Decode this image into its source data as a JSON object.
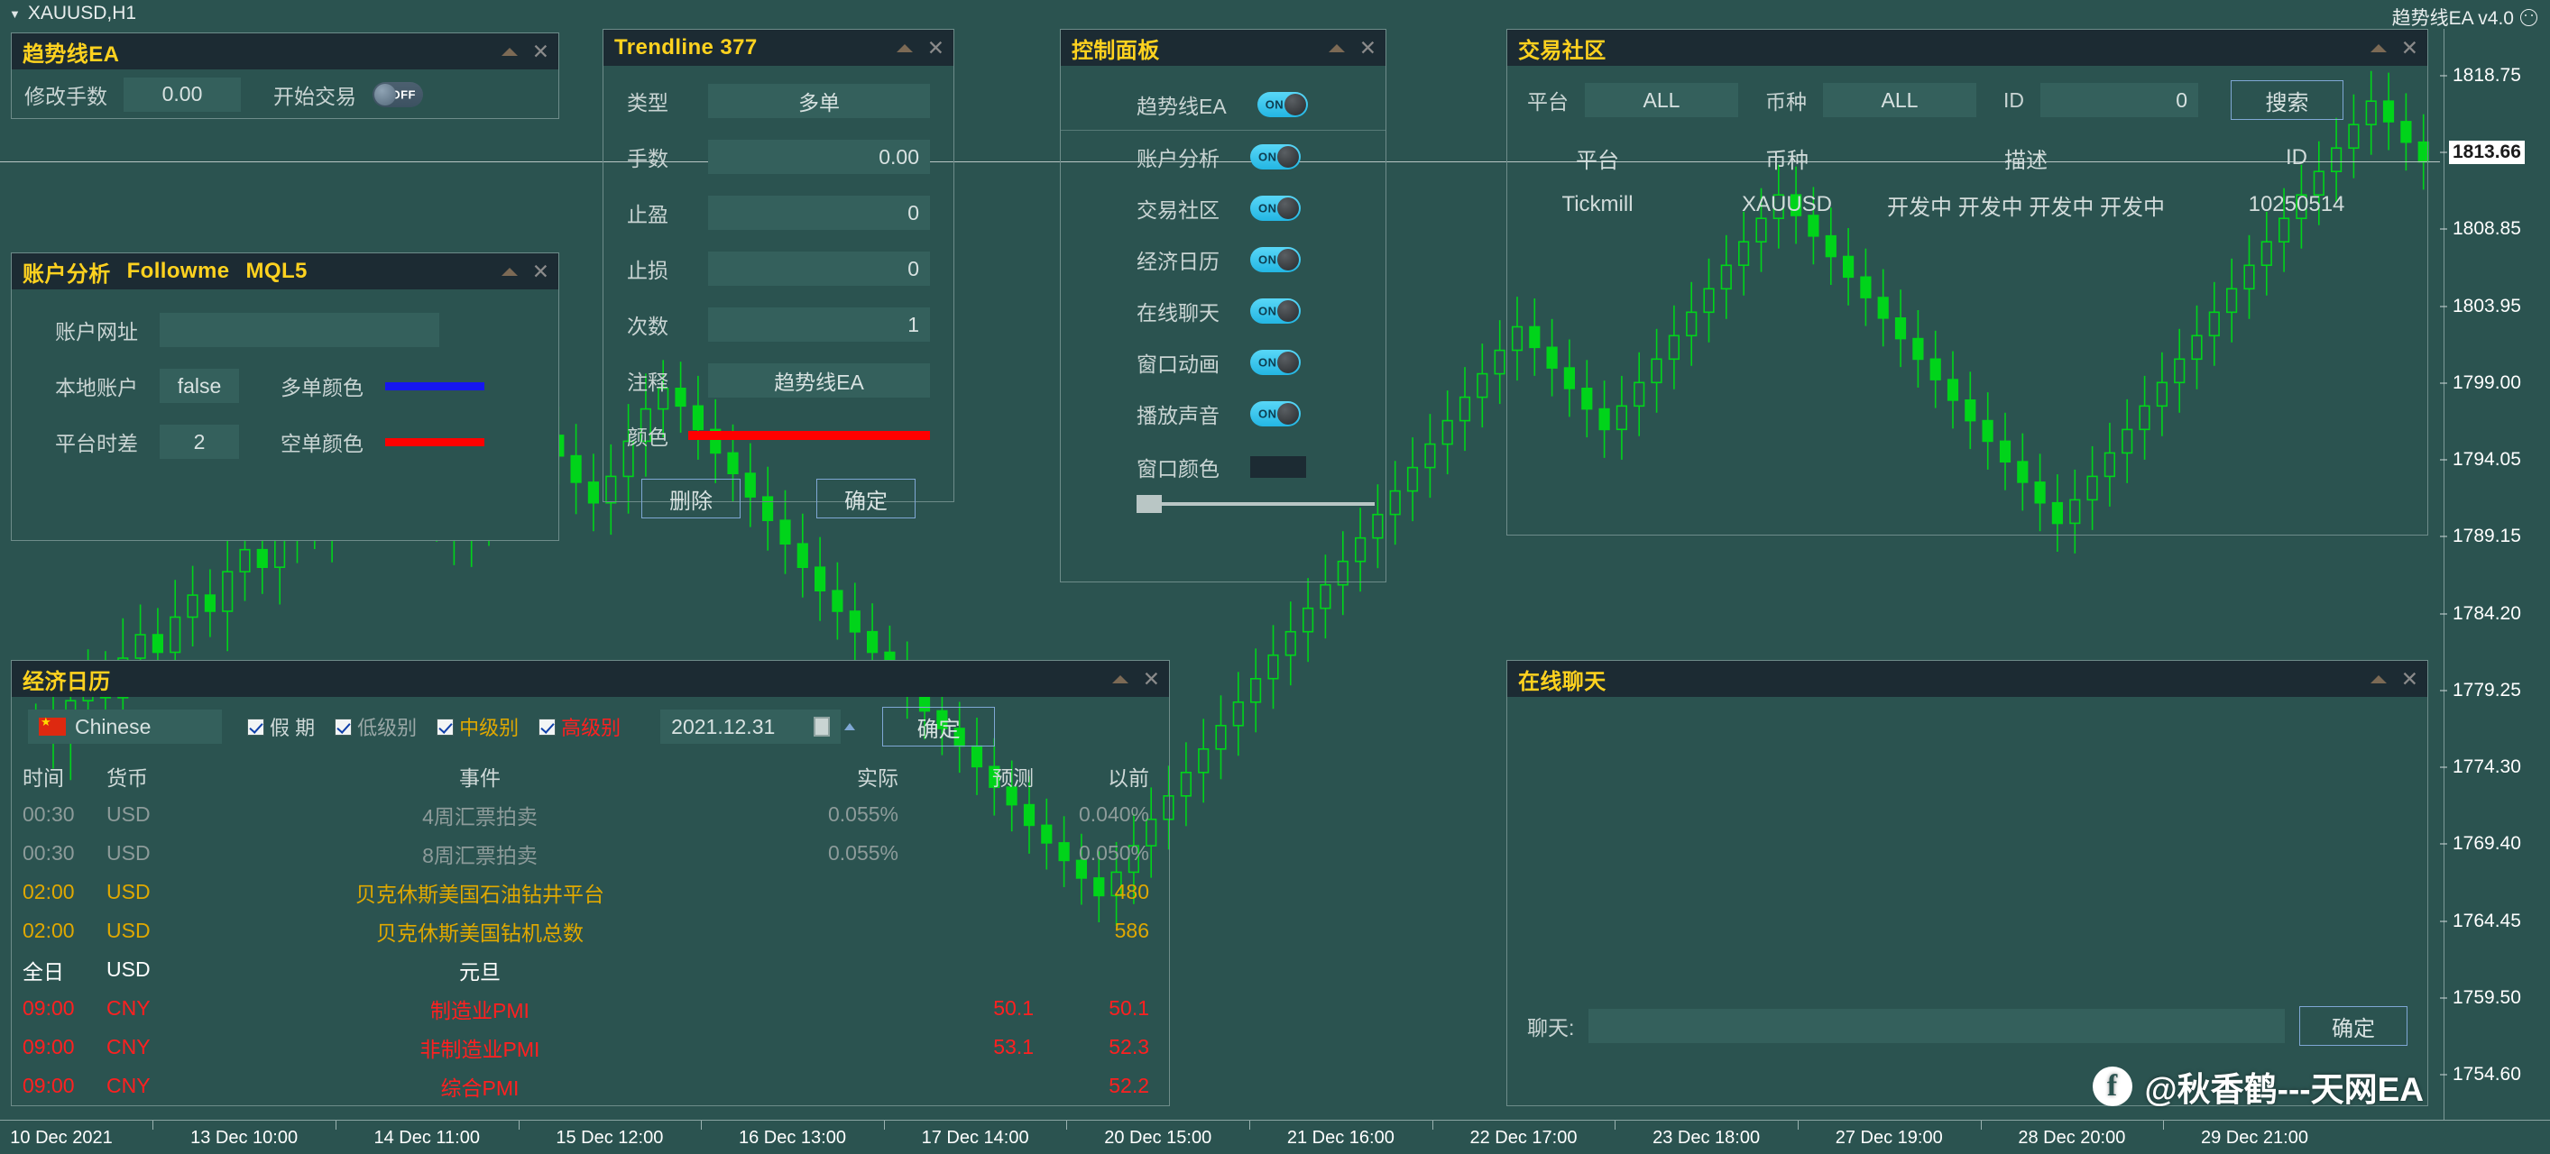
{
  "window": {
    "symbol_tab": "XAUUSD,H1",
    "brand": "趋势线EA v4.0"
  },
  "chart_data": {
    "type": "line",
    "title": "XAUUSD,H1",
    "xlabel": "",
    "ylabel": "",
    "ylim": [
      1752.0,
      1821.5
    ],
    "grid": false,
    "legend": "none",
    "current_price": "1813.66",
    "y_ticks": [
      "1818.75",
      "1813.66",
      "1808.85",
      "1803.95",
      "1799.00",
      "1794.05",
      "1789.15",
      "1784.20",
      "1779.25",
      "1774.30",
      "1769.40",
      "1764.45",
      "1759.50",
      "1754.60"
    ],
    "x_ticks": [
      "10 Dec 2021",
      "13 Dec 10:00",
      "14 Dec 11:00",
      "15 Dec 12:00",
      "16 Dec 13:00",
      "17 Dec 14:00",
      "20 Dec 15:00",
      "21 Dec 16:00",
      "22 Dec 17:00",
      "23 Dec 18:00",
      "27 Dec 19:00",
      "28 Dec 20:00",
      "29 Dec 21:00"
    ],
    "series": [
      {
        "name": "XAUUSD H1 candles",
        "type": "candlestick",
        "color": "#00d41a",
        "values": [
          1775.6,
          1774.2,
          1776.9,
          1778.4,
          1777.1,
          1779.8,
          1781.4,
          1780.2,
          1782.6,
          1784.1,
          1783.0,
          1785.7,
          1787.2,
          1786.0,
          1788.4,
          1790.1,
          1789.0,
          1791.6,
          1793.2,
          1792.0,
          1794.5,
          1793.1,
          1791.4,
          1789.8,
          1788.2,
          1790.0,
          1792.4,
          1794.8,
          1796.2,
          1795.0,
          1793.6,
          1791.8,
          1790.4,
          1792.2,
          1794.6,
          1796.8,
          1798.2,
          1797.0,
          1795.4,
          1793.8,
          1792.4,
          1790.8,
          1789.2,
          1787.6,
          1786.0,
          1784.4,
          1783.0,
          1781.6,
          1780.2,
          1779.0,
          1777.6,
          1776.2,
          1775.0,
          1773.8,
          1772.4,
          1771.0,
          1769.8,
          1768.4,
          1767.2,
          1766.0,
          1764.8,
          1763.6,
          1765.2,
          1767.0,
          1768.8,
          1770.4,
          1772.0,
          1773.6,
          1775.2,
          1776.8,
          1778.4,
          1780.0,
          1781.6,
          1783.2,
          1784.8,
          1786.4,
          1788.0,
          1789.6,
          1791.2,
          1792.8,
          1794.4,
          1796.0,
          1797.6,
          1799.2,
          1800.8,
          1802.4,
          1801.0,
          1799.6,
          1798.2,
          1796.8,
          1795.4,
          1797.0,
          1798.6,
          1800.2,
          1801.8,
          1803.4,
          1805.0,
          1806.6,
          1808.2,
          1809.8,
          1811.4,
          1810.0,
          1808.6,
          1807.2,
          1805.8,
          1804.4,
          1803.0,
          1801.6,
          1800.2,
          1798.8,
          1797.4,
          1796.0,
          1794.6,
          1793.2,
          1791.8,
          1790.4,
          1789.0,
          1790.6,
          1792.2,
          1793.8,
          1795.4,
          1797.0,
          1798.6,
          1800.2,
          1801.8,
          1803.4,
          1805.0,
          1806.6,
          1808.2,
          1809.8,
          1811.4,
          1813.0,
          1814.6,
          1816.2,
          1817.8,
          1816.4,
          1815.0,
          1813.66
        ]
      }
    ]
  },
  "trendline_ea_panel": {
    "title": "趋势线EA",
    "lot_label": "修改手数",
    "lot_value": "0.00",
    "start_label": "开始交易",
    "start_toggle": "OFF"
  },
  "account_panel": {
    "title_main": "账户分析",
    "title_followme": "Followme",
    "title_mql5": "MQL5",
    "rows": [
      {
        "label": "账户网址",
        "value": ""
      },
      {
        "label": "本地账户",
        "value": "false"
      },
      {
        "label": "平台时差",
        "value": "2"
      }
    ],
    "color_rows": [
      {
        "label": "多单颜色",
        "color": "#1616ef"
      },
      {
        "label": "空单颜色",
        "color": "#ff0000"
      }
    ]
  },
  "trendline_dialog": {
    "title": "Trendline 377",
    "fields": [
      {
        "label": "类型",
        "value": "多单",
        "align": "center"
      },
      {
        "label": "手数",
        "value": "0.00",
        "align": "right"
      },
      {
        "label": "止盈",
        "value": "0",
        "align": "right"
      },
      {
        "label": "止损",
        "value": "0",
        "align": "right"
      },
      {
        "label": "次数",
        "value": "1",
        "align": "right"
      },
      {
        "label": "注释",
        "value": "趋势线EA",
        "align": "center"
      }
    ],
    "color_label": "颜色",
    "color_value": "#ff0000",
    "delete_label": "删除",
    "confirm_label": "确定"
  },
  "control_panel": {
    "title": "控制面板",
    "items": [
      {
        "label": "趋势线EA",
        "state": "ON"
      },
      {
        "label": "账户分析",
        "state": "ON"
      },
      {
        "label": "交易社区",
        "state": "ON"
      },
      {
        "label": "经济日历",
        "state": "ON"
      },
      {
        "label": "在线聊天",
        "state": "ON"
      },
      {
        "label": "窗口动画",
        "state": "ON"
      },
      {
        "label": "播放声音",
        "state": "ON"
      }
    ],
    "window_color_label": "窗口颜色",
    "window_color_value": "#1c2b33"
  },
  "community_panel": {
    "title": "交易社区",
    "filters": {
      "platform_label": "平台",
      "platform_value": "ALL",
      "symbol_label": "币种",
      "symbol_value": "ALL",
      "id_label": "ID",
      "id_value": "0",
      "search_label": "搜索"
    },
    "columns": [
      "平台",
      "币种",
      "描述",
      "ID"
    ],
    "rows": [
      {
        "platform": "Tickmill",
        "symbol": "XAUUSD",
        "desc": "开发中 开发中 开发中 开发中",
        "id": "10250514"
      }
    ]
  },
  "calendar_panel": {
    "title": "经济日历",
    "language": "Chinese",
    "filters": [
      {
        "label": "假 期",
        "color": "#cfd9d8",
        "checked": true
      },
      {
        "label": "低级别",
        "color": "#9aa8a7",
        "checked": true
      },
      {
        "label": "中级别",
        "color": "#e0a800",
        "checked": true
      },
      {
        "label": "高级别",
        "color": "#ff2020",
        "checked": true
      }
    ],
    "date_value": "2021.12.31",
    "confirm_label": "确定",
    "columns": [
      "时间",
      "货币",
      "事件",
      "实际",
      "预测",
      "以前"
    ],
    "rows": [
      {
        "time": "00:30",
        "currency": "USD",
        "event": "4周汇票拍卖",
        "actual": "0.055%",
        "forecast": "",
        "previous": "0.040%",
        "level": "low"
      },
      {
        "time": "00:30",
        "currency": "USD",
        "event": "8周汇票拍卖",
        "actual": "0.055%",
        "forecast": "",
        "previous": "0.050%",
        "level": "low"
      },
      {
        "time": "02:00",
        "currency": "USD",
        "event": "贝克休斯美国石油钻井平台",
        "actual": "",
        "forecast": "",
        "previous": "480",
        "level": "mid"
      },
      {
        "time": "02:00",
        "currency": "USD",
        "event": "贝克休斯美国钻机总数",
        "actual": "",
        "forecast": "",
        "previous": "586",
        "level": "mid"
      },
      {
        "time": "全日",
        "currency": "USD",
        "event": "元旦",
        "actual": "",
        "forecast": "",
        "previous": "",
        "level": "holiday"
      },
      {
        "time": "09:00",
        "currency": "CNY",
        "event": "制造业PMI",
        "actual": "",
        "forecast": "50.1",
        "previous": "50.1",
        "level": "high"
      },
      {
        "time": "09:00",
        "currency": "CNY",
        "event": "非制造业PMI",
        "actual": "",
        "forecast": "53.1",
        "previous": "52.3",
        "level": "high"
      },
      {
        "time": "09:00",
        "currency": "CNY",
        "event": "综合PMI",
        "actual": "",
        "forecast": "",
        "previous": "52.2",
        "level": "high"
      }
    ]
  },
  "chat_panel": {
    "title": "在线聊天",
    "input_label": "聊天:",
    "input_value": "",
    "send_label": "确定"
  },
  "watermark": {
    "text": "@秋香鹤---天网EA",
    "icon": "facebook-icon"
  },
  "colors": {
    "background": "#2b5350",
    "panel_title_bg": "#1c2b33",
    "title_text": "#ffd21f",
    "field_bg": "#34605c",
    "label_text": "#c9d4d3",
    "toggle_on": "#3fc6ef",
    "bull_candle": "#00d41a",
    "accent_border": "#7fa7d4"
  }
}
